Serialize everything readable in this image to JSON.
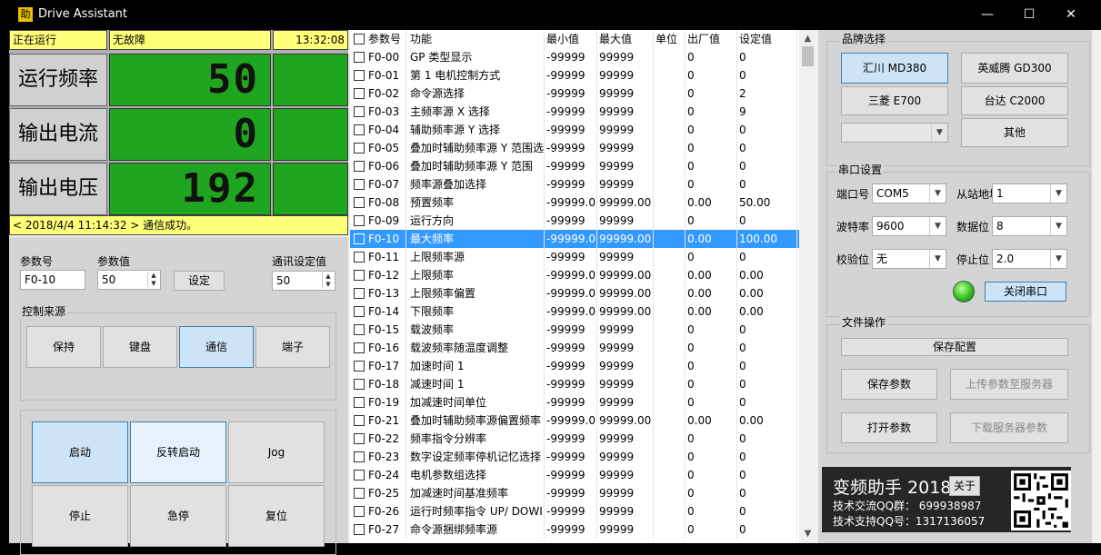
{
  "window": {
    "title": "Drive Assistant",
    "icon_glyph": "助",
    "minimize": "—",
    "maximize": "☐",
    "close": "✕"
  },
  "status": {
    "run_state": "正在运行",
    "fault": "无故障",
    "time": "13:32:08",
    "message": "< 2018/4/4 11:14:32 > 通信成功。"
  },
  "measures": [
    {
      "label": "运行频率",
      "value": "50"
    },
    {
      "label": "输出电流",
      "value": "0"
    },
    {
      "label": "输出电压",
      "value": "192"
    }
  ],
  "params": {
    "param_no_label": "参数号",
    "param_no_value": "F0-10",
    "param_val_label": "参数值",
    "param_val_value": "50",
    "set_button": "设定",
    "comm_set_label": "通讯设定值",
    "comm_set_value": "50"
  },
  "control_source": {
    "title": "控制来源",
    "buttons": [
      "保持",
      "键盘",
      "通信",
      "端子"
    ],
    "selected": "通信"
  },
  "run_buttons": [
    "启动",
    "反转启动",
    "Jog",
    "停止",
    "急停",
    "复位"
  ],
  "table": {
    "columns": [
      "参数号",
      "功能",
      "最小值",
      "最大值",
      "单位",
      "出厂值",
      "设定值"
    ],
    "rows": [
      [
        "F0-00",
        "GP 类型显示",
        "-99999",
        "99999",
        "",
        "0",
        "0"
      ],
      [
        "F0-01",
        "第 1 电机控制方式",
        "-99999",
        "99999",
        "",
        "0",
        "0"
      ],
      [
        "F0-02",
        "命令源选择",
        "-99999",
        "99999",
        "",
        "0",
        "2"
      ],
      [
        "F0-03",
        "主频率源 X 选择",
        "-99999",
        "99999",
        "",
        "0",
        "9"
      ],
      [
        "F0-04",
        "辅助频率源 Y 选择",
        "-99999",
        "99999",
        "",
        "0",
        "0"
      ],
      [
        "F0-05",
        "叠加时辅助频率源 Y 范围选",
        "-99999",
        "99999",
        "",
        "0",
        "0"
      ],
      [
        "F0-06",
        "叠加时辅助频率源 Y 范围",
        "-99999",
        "99999",
        "",
        "0",
        "0"
      ],
      [
        "F0-07",
        "频率源叠加选择",
        "-99999",
        "99999",
        "",
        "0",
        "0"
      ],
      [
        "F0-08",
        "预置频率",
        "-99999.0",
        "99999.00",
        "",
        "0.00",
        "50.00"
      ],
      [
        "F0-09",
        "运行方向",
        "-99999",
        "99999",
        "",
        "0",
        "0"
      ],
      [
        "F0-10",
        "最大频率",
        "-99999.0",
        "99999.00",
        "",
        "0.00",
        "100.00"
      ],
      [
        "F0-11",
        "上限频率源",
        "-99999",
        "99999",
        "",
        "0",
        "0"
      ],
      [
        "F0-12",
        "上限频率",
        "-99999.0",
        "99999.00",
        "",
        "0.00",
        "0.00"
      ],
      [
        "F0-13",
        "上限频率偏置",
        "-99999.0",
        "99999.00",
        "",
        "0.00",
        "0.00"
      ],
      [
        "F0-14",
        "下限频率",
        "-99999.0",
        "99999.00",
        "",
        "0.00",
        "0.00"
      ],
      [
        "F0-15",
        "载波频率",
        "-99999",
        "99999",
        "",
        "0",
        "0"
      ],
      [
        "F0-16",
        "载波频率随温度调整",
        "-99999",
        "99999",
        "",
        "0",
        "0"
      ],
      [
        "F0-17",
        "加速时间 1",
        "-99999",
        "99999",
        "",
        "0",
        "0"
      ],
      [
        "F0-18",
        "减速时间 1",
        "-99999",
        "99999",
        "",
        "0",
        "0"
      ],
      [
        "F0-19",
        "加减速时间单位",
        "-99999",
        "99999",
        "",
        "0",
        "0"
      ],
      [
        "F0-21",
        "叠加时辅助频率源偏置频率",
        "-99999.0",
        "99999.00",
        "",
        "0.00",
        "0.00"
      ],
      [
        "F0-22",
        "频率指令分辨率",
        "-99999",
        "99999",
        "",
        "0",
        "0"
      ],
      [
        "F0-23",
        "数字设定频率停机记忆选择",
        "-99999",
        "99999",
        "",
        "0",
        "0"
      ],
      [
        "F0-24",
        "电机参数组选择",
        "-99999",
        "99999",
        "",
        "0",
        "0"
      ],
      [
        "F0-25",
        "加减速时间基准频率",
        "-99999",
        "99999",
        "",
        "0",
        "0"
      ],
      [
        "F0-26",
        "运行时频率指令 UP/ DOWI",
        "-99999",
        "99999",
        "",
        "0",
        "0"
      ],
      [
        "F0-27",
        "命令源捆绑频率源",
        "-99999",
        "99999",
        "",
        "0",
        "0"
      ]
    ],
    "selected_row": 10
  },
  "brand": {
    "title": "品牌选择",
    "buttons": [
      "汇川 MD380",
      "英威腾 GD300",
      "三菱 E700",
      "台达 C2000",
      "其他"
    ],
    "selected": "汇川 MD380",
    "dropdown_value": ""
  },
  "serial": {
    "title": "串口设置",
    "port_label": "端口号",
    "port_value": "COM5",
    "slave_label": "从站地址",
    "slave_value": "1",
    "baud_label": "波特率",
    "baud_value": "9600",
    "data_label": "数据位",
    "data_value": "8",
    "parity_label": "校验位",
    "parity_value": "无",
    "stop_label": "停止位",
    "stop_value": "2.0",
    "close_button": "关闭串口",
    "led_color": "#2fc21c"
  },
  "file_ops": {
    "title": "文件操作",
    "save_config": "保存配置",
    "save_params": "保存参数",
    "upload": "上传参数至服务器",
    "open_params": "打开参数",
    "download": "下载服务器参数"
  },
  "about": {
    "title": "变频助手 2018",
    "about_button": "关于",
    "qq_group": "技术交流QQ群： 699938987",
    "qq_support": "技术支持QQ号：1317136057"
  }
}
